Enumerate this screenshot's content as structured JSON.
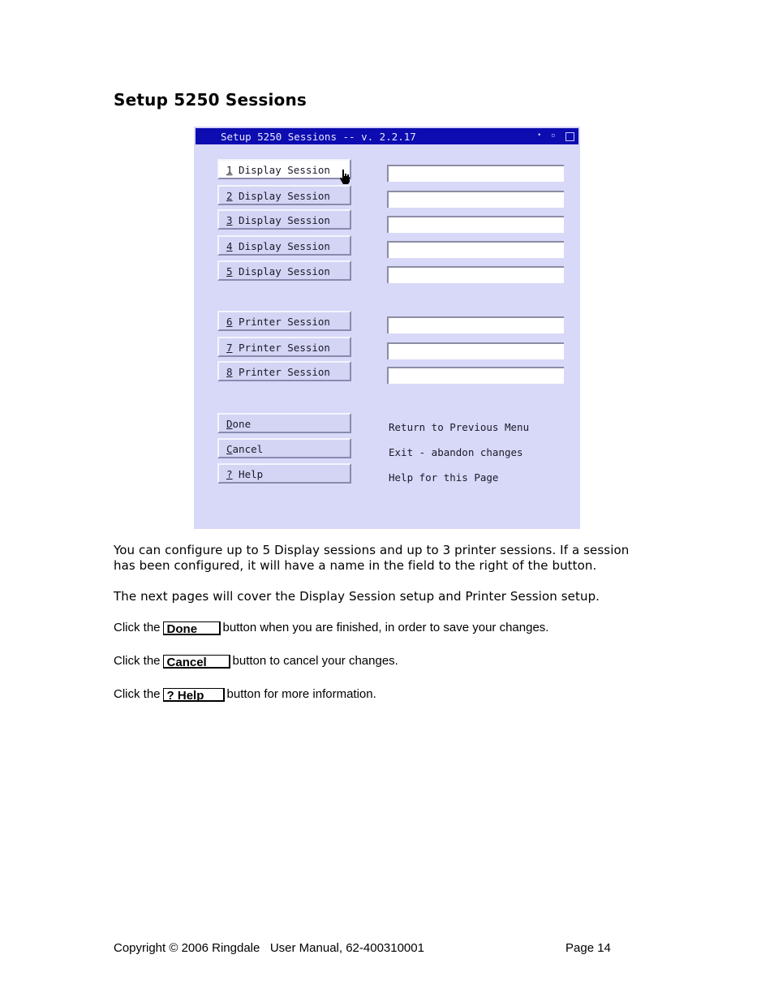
{
  "page": {
    "heading": "Setup 5250 Sessions",
    "window": {
      "title": "Setup 5250 Sessions -- v. 2.2.17",
      "controls": {
        "dot1": "•",
        "dot2": "▫"
      },
      "display_sessions": [
        {
          "key": "1",
          "label": " Display Session",
          "field_value": ""
        },
        {
          "key": "2",
          "label": " Display Session",
          "field_value": ""
        },
        {
          "key": "3",
          "label": " Display Session",
          "field_value": ""
        },
        {
          "key": "4",
          "label": " Display Session",
          "field_value": ""
        },
        {
          "key": "5",
          "label": " Display Session",
          "field_value": ""
        }
      ],
      "printer_sessions": [
        {
          "key": "6",
          "label": " Printer Session",
          "field_value": ""
        },
        {
          "key": "7",
          "label": " Printer Session",
          "field_value": ""
        },
        {
          "key": "8",
          "label": " Printer Session",
          "field_value": ""
        }
      ],
      "actions": [
        {
          "key": "D",
          "label": "one",
          "description": "Return to Previous Menu"
        },
        {
          "key": "C",
          "label": "ancel",
          "description": "Exit - abandon changes"
        },
        {
          "key": "?",
          "label": " Help",
          "description": "Help for this Page"
        }
      ]
    },
    "paragraphs": {
      "p1_line1": "You can configure up to 5 Display sessions and up to 3 printer sessions. If a session",
      "p1_line2": "has been configured, it will have a name in the field to the right of the button.",
      "p2": "The next pages will cover the Display Session setup and Printer Session setup."
    },
    "instructions": [
      {
        "prefix": "Click the",
        "button": "Done",
        "suffix": "button when you are finished, in order to save your changes."
      },
      {
        "prefix": "Click the",
        "button": "Cancel",
        "suffix": "button to cancel your changes."
      },
      {
        "prefix": "Click the",
        "button": "? Help",
        "suffix": "button for more information."
      }
    ],
    "footer": {
      "left": "Copyright © 2006 Ringdale   User Manual, 62-400310001",
      "right": "Page 14"
    }
  }
}
